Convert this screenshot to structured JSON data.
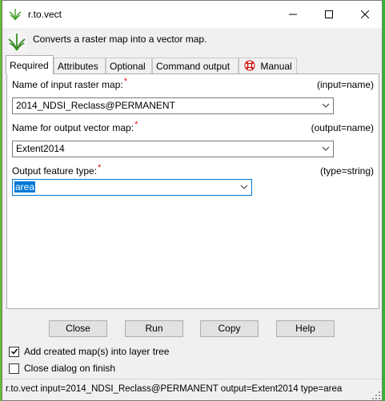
{
  "window": {
    "title": "r.to.vect"
  },
  "header": {
    "description": "Converts a raster map into a vector map."
  },
  "tabs": [
    {
      "label": "Required"
    },
    {
      "label": "Attributes"
    },
    {
      "label": "Optional"
    },
    {
      "label": "Command output"
    },
    {
      "label": "Manual"
    }
  ],
  "fields": [
    {
      "label": "Name of input raster map:",
      "required": "*",
      "hint": "(input=name)",
      "value": "2014_NDSI_Reclass@PERMANENT"
    },
    {
      "label": "Name for output vector map:",
      "required": "*",
      "hint": "(output=name)",
      "value": "Extent2014"
    },
    {
      "label": "Output feature type:",
      "required": "*",
      "hint": "(type=string)",
      "value": "area"
    }
  ],
  "buttons": {
    "close": "Close",
    "run": "Run",
    "copy": "Copy",
    "help": "Help"
  },
  "options": {
    "add_to_tree": {
      "label": "Add created map(s) into layer tree",
      "checked": true
    },
    "close_on_finish": {
      "label": "Close dialog on finish",
      "checked": false
    }
  },
  "status": {
    "command": "r.to.vect input=2014_NDSI_Reclass@PERMANENT output=Extent2014 type=area"
  },
  "colors": {
    "accent": "#0078d7",
    "required": "#dd1111"
  }
}
